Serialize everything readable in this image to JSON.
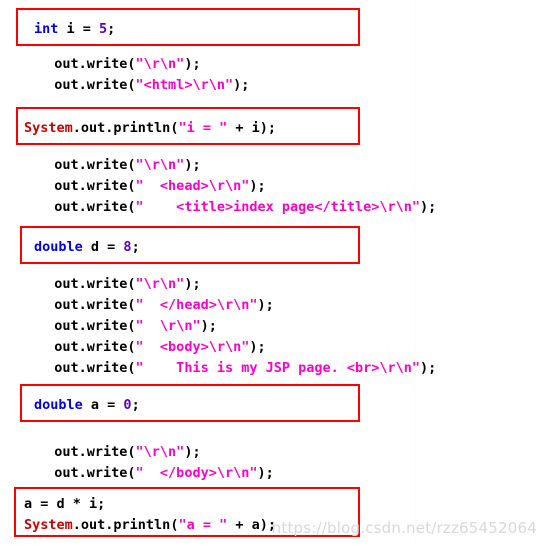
{
  "page": {
    "kind": "code-screenshot",
    "language": "Java (JSP generated servlet)",
    "background_color": "#ffffff",
    "highlight_color": "#ff0000"
  },
  "colors": {
    "keyword": "#0000ee",
    "number": "#5500cc",
    "string": "#ff00cc",
    "class_name": "#cc0000",
    "plain": "#000000",
    "highlight_border": "#ff0000",
    "watermark": "#d8d8d8"
  },
  "blocks": [
    {
      "id": "block-int-i",
      "highlighted": true,
      "lines": [
        {
          "id": "line-int-i",
          "tokens": [
            {
              "t": "int",
              "c": "kw"
            },
            {
              "t": " i = ",
              "c": "plain"
            },
            {
              "t": "5",
              "c": "num"
            },
            {
              "t": ";",
              "c": "plain"
            }
          ]
        }
      ]
    },
    {
      "id": "block-write-1",
      "highlighted": false,
      "lines": [
        {
          "id": "line-write-crlf-1",
          "tokens": [
            {
              "t": "  out.write(",
              "c": "plain"
            },
            {
              "t": "\"\\r\\n\"",
              "c": "str"
            },
            {
              "t": ");",
              "c": "plain"
            }
          ]
        },
        {
          "id": "line-write-html",
          "tokens": [
            {
              "t": "  out.write(",
              "c": "plain"
            },
            {
              "t": "\"<html>\\r\\n\"",
              "c": "str"
            },
            {
              "t": ");",
              "c": "plain"
            }
          ]
        }
      ]
    },
    {
      "id": "block-println-i",
      "highlighted": true,
      "lines": [
        {
          "id": "line-println-i",
          "tokens": [
            {
              "t": "System",
              "c": "cls"
            },
            {
              "t": ".out.println(",
              "c": "plain"
            },
            {
              "t": "\"i = \"",
              "c": "str"
            },
            {
              "t": " + i);",
              "c": "plain"
            }
          ]
        }
      ]
    },
    {
      "id": "block-write-2",
      "highlighted": false,
      "lines": [
        {
          "id": "line-write-crlf-2",
          "tokens": [
            {
              "t": "  out.write(",
              "c": "plain"
            },
            {
              "t": "\"\\r\\n\"",
              "c": "str"
            },
            {
              "t": ");",
              "c": "plain"
            }
          ]
        },
        {
          "id": "line-write-head",
          "tokens": [
            {
              "t": "  out.write(",
              "c": "plain"
            },
            {
              "t": "\"  <head>\\r\\n\"",
              "c": "str"
            },
            {
              "t": ");",
              "c": "plain"
            }
          ]
        },
        {
          "id": "line-write-title",
          "tokens": [
            {
              "t": "  out.write(",
              "c": "plain"
            },
            {
              "t": "\"    <title>index page</title>\\r\\n\"",
              "c": "str"
            },
            {
              "t": ");",
              "c": "plain"
            }
          ]
        }
      ]
    },
    {
      "id": "block-double-d",
      "highlighted": true,
      "lines": [
        {
          "id": "line-double-d",
          "tokens": [
            {
              "t": "double",
              "c": "kw"
            },
            {
              "t": " d = ",
              "c": "plain"
            },
            {
              "t": "8",
              "c": "num"
            },
            {
              "t": ";",
              "c": "plain"
            }
          ]
        }
      ]
    },
    {
      "id": "block-write-3",
      "highlighted": false,
      "lines": [
        {
          "id": "line-write-crlf-3",
          "tokens": [
            {
              "t": "  out.write(",
              "c": "plain"
            },
            {
              "t": "\"\\r\\n\"",
              "c": "str"
            },
            {
              "t": ");",
              "c": "plain"
            }
          ]
        },
        {
          "id": "line-write-head-close",
          "tokens": [
            {
              "t": "  out.write(",
              "c": "plain"
            },
            {
              "t": "\"  </head>\\r\\n\"",
              "c": "str"
            },
            {
              "t": ");",
              "c": "plain"
            }
          ]
        },
        {
          "id": "line-write-blank",
          "tokens": [
            {
              "t": "  out.write(",
              "c": "plain"
            },
            {
              "t": "\"  \\r\\n\"",
              "c": "str"
            },
            {
              "t": ");",
              "c": "plain"
            }
          ]
        },
        {
          "id": "line-write-body",
          "tokens": [
            {
              "t": "  out.write(",
              "c": "plain"
            },
            {
              "t": "\"  <body>\\r\\n\"",
              "c": "str"
            },
            {
              "t": ");",
              "c": "plain"
            }
          ]
        },
        {
          "id": "line-write-jsp-page",
          "tokens": [
            {
              "t": "  out.write(",
              "c": "plain"
            },
            {
              "t": "\"    This is my JSP page. <br>\\r\\n\"",
              "c": "str"
            },
            {
              "t": ");",
              "c": "plain"
            }
          ]
        }
      ]
    },
    {
      "id": "block-double-a",
      "highlighted": true,
      "lines": [
        {
          "id": "line-double-a",
          "tokens": [
            {
              "t": "double",
              "c": "kw"
            },
            {
              "t": " a = ",
              "c": "plain"
            },
            {
              "t": "0",
              "c": "num"
            },
            {
              "t": ";",
              "c": "plain"
            }
          ]
        }
      ]
    },
    {
      "id": "block-write-4",
      "highlighted": false,
      "lines": [
        {
          "id": "line-write-crlf-4",
          "tokens": [
            {
              "t": "  out.write(",
              "c": "plain"
            },
            {
              "t": "\"\\r\\n\"",
              "c": "str"
            },
            {
              "t": ");",
              "c": "plain"
            }
          ]
        },
        {
          "id": "line-write-body-close",
          "tokens": [
            {
              "t": "  out.write(",
              "c": "plain"
            },
            {
              "t": "\"  </body>\\r\\n\"",
              "c": "str"
            },
            {
              "t": ");",
              "c": "plain"
            }
          ]
        }
      ]
    },
    {
      "id": "block-calc-a",
      "highlighted": true,
      "lines": [
        {
          "id": "line-a-assign",
          "tokens": [
            {
              "t": "a = d * i;",
              "c": "plain"
            }
          ]
        },
        {
          "id": "line-println-a",
          "tokens": [
            {
              "t": "System",
              "c": "cls"
            },
            {
              "t": ".out.println(",
              "c": "plain"
            },
            {
              "t": "\"a = \"",
              "c": "str"
            },
            {
              "t": " + a);",
              "c": "plain"
            }
          ]
        }
      ]
    }
  ],
  "watermark": {
    "text": "https://blog.csdn.net/rzz65452064"
  }
}
